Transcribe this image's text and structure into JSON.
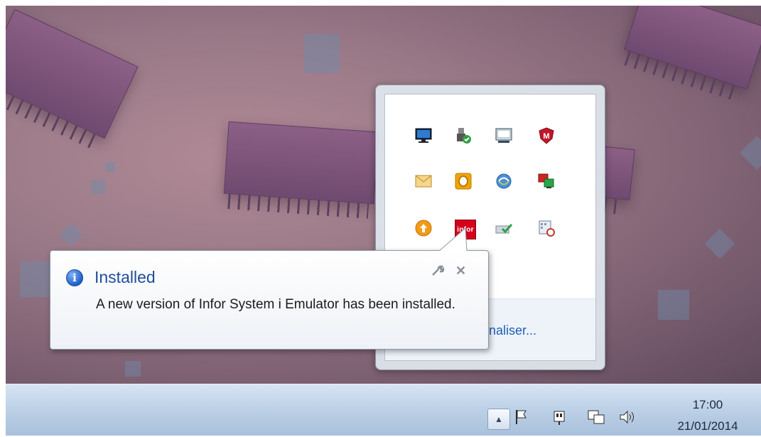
{
  "balloon": {
    "title": "Installed",
    "message": "A new version of Infor System i Emulator has been installed.",
    "options_icon": "wrench-icon",
    "close_icon": "close-icon"
  },
  "tray": {
    "customize_label": "naliser...",
    "icons": [
      "monitor-icon",
      "usb-safely-remove-icon",
      "display-icon",
      "mcafee-icon",
      "mail-icon",
      "outlook-icon",
      "globe-sync-icon",
      "network-icon",
      "upload-icon",
      "infor-icon",
      "check-device-icon",
      "calendar-icon"
    ],
    "infor_label": "infor"
  },
  "taskbar": {
    "show_hidden_icon": "triangle-up-icon",
    "time": "17:00",
    "date": "21/01/2014"
  }
}
